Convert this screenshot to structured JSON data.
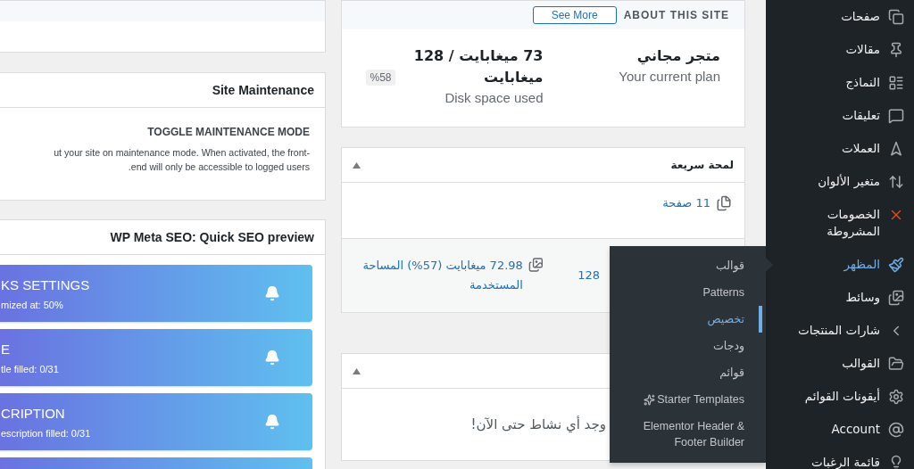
{
  "sidebar": {
    "items": [
      {
        "label": "صفحات",
        "selected": false
      },
      {
        "label": "مقالات",
        "selected": false
      },
      {
        "label": "النماذج",
        "selected": false
      },
      {
        "label": "تعليقات",
        "selected": false
      },
      {
        "label": "العملات",
        "selected": false
      },
      {
        "label": "متغير الألوان",
        "selected": false
      },
      {
        "label": "الخصومات المشروطة",
        "selected": false
      },
      {
        "label": "المظهر",
        "selected": true,
        "submenu": [
          {
            "label": "قوالب",
            "selected": false
          },
          {
            "label": "Patterns",
            "selected": false
          },
          {
            "label": "تخصيص",
            "selected": true
          },
          {
            "label": "ودجات",
            "selected": false
          },
          {
            "label": "قوائم",
            "selected": false
          },
          {
            "label": "Starter Templates",
            "selected": false
          },
          {
            "label": "Elementor Header & Footer Builder",
            "selected": false
          }
        ]
      },
      {
        "label": "وسائط",
        "selected": false
      },
      {
        "label": "شارات المنتجات",
        "selected": false
      },
      {
        "label": "القوالب",
        "selected": false
      },
      {
        "label": "أيقونات القوائم",
        "selected": false
      },
      {
        "label": "Account",
        "selected": false
      },
      {
        "label": "قائمة الرغبات",
        "selected": false
      }
    ]
  },
  "site_info": {
    "heading": "ABOUT THIS SITE",
    "button": "See More",
    "plan_name": "متجر مجاني",
    "plan_caption": "Your current plan",
    "disk_usage": "73 ميغابايت / 128 ميغابايت",
    "disk_percent": "%58",
    "disk_caption": "Disk space used"
  },
  "at_a_glance": {
    "title": "لمحة سريعة",
    "pages": "11 صفحة",
    "storage_total": "128",
    "storage_used": "72.98 ميغابايت (57%) المساحة المستخدمة"
  },
  "activity": {
    "empty_message": "وجد أي نشاط حتى الآن!"
  },
  "site_maintenance": {
    "title": "Site Maintenance",
    "toggle_heading": "TOGGLE MAINTENANCE MODE",
    "description_lines": [
      "ut your site on maintenance mode. When activated, the front-",
      ".end will only be accessible to logged users"
    ]
  },
  "seo_preview": {
    "title": "WP Meta SEO: Quick SEO preview",
    "cards": [
      {
        "kind": "metric",
        "title": "KS SETTINGS",
        "detail": "mized at: 50%"
      },
      {
        "kind": "metric",
        "title": "E",
        "detail": "tle filled: 0/31"
      },
      {
        "kind": "metric",
        "title": "CRIPTION",
        "detail": "escription filled: 0/31"
      },
      {
        "kind": "empty"
      }
    ]
  }
}
